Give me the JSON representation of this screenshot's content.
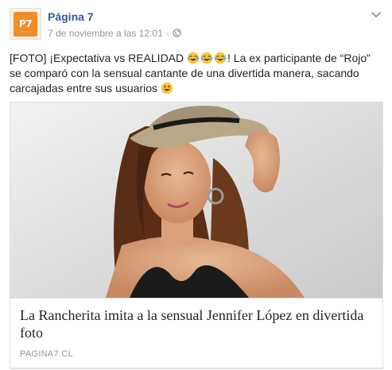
{
  "post": {
    "page_name": "Página 7",
    "avatar_text": "P7",
    "timestamp": "7 de noviembre a las 12:01",
    "separator": "·",
    "privacy_icon": "globe-icon",
    "menu_icon": "chevron-down-icon",
    "text_part1": "[FOTO] ¡Expectativa vs REALIDAD ",
    "text_part2": "! La ex participante de “Rojo” se comparó con la sensual cantante de una divertida manera, sacando carcajadas entre sus usuarios ",
    "emoji_laugh": "tears-of-joy-emoji",
    "emoji_smile": "smiley-emoji"
  },
  "link": {
    "title": "La Rancherita imita a la sensual Jennifer López en divertida foto",
    "domain": "PAGINA7.CL"
  },
  "colors": {
    "link_blue": "#365899",
    "meta_gray": "#90949c",
    "text": "#1d2129",
    "border": "#dddfe2",
    "brand_orange": "#f28c28"
  }
}
